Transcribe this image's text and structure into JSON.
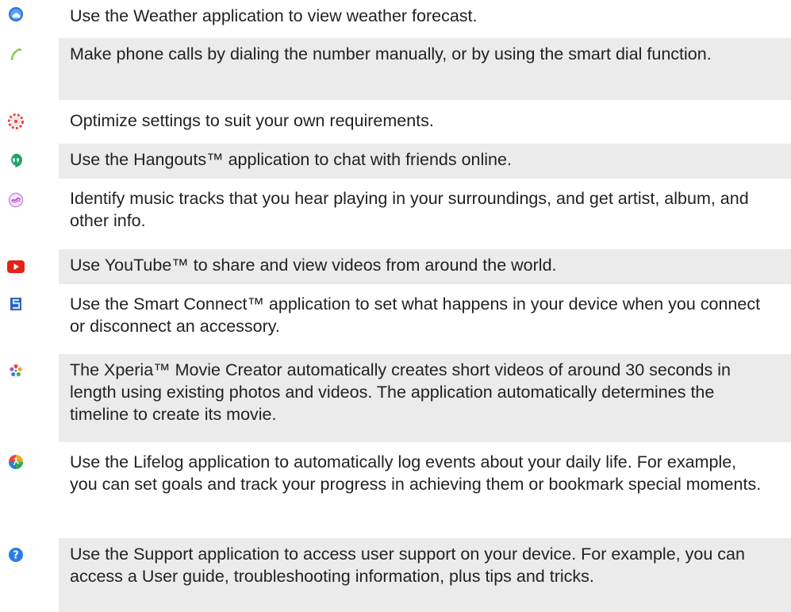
{
  "items": [
    {
      "icon": "weather-icon",
      "text": "Use the Weather application to view weather forecast."
    },
    {
      "icon": "phone-icon",
      "text": "Make phone calls by dialing the number manually, or by using the smart dial function."
    },
    {
      "icon": "settings-icon",
      "text": "Optimize settings to suit your own requirements."
    },
    {
      "icon": "hangouts-icon",
      "text": "Use the Hangouts™ application to chat with friends online."
    },
    {
      "icon": "trackid-icon",
      "text": "Identify music tracks that you hear playing in your surroundings, and get artist, album, and other info."
    },
    {
      "icon": "youtube-icon",
      "text": "Use YouTube™ to share and view videos from around the world."
    },
    {
      "icon": "smart-connect-icon",
      "text": "Use the Smart Connect™ application to set what happens in your device when you connect or disconnect an accessory."
    },
    {
      "icon": "movie-creator-icon",
      "text": "The Xperia™ Movie Creator automatically creates short videos of around 30 seconds in length using existing photos and videos. The application automatically determines the timeline to create its movie."
    },
    {
      "icon": "lifelog-icon",
      "text": "Use the Lifelog application to automatically log events about your daily life. For example, you can set goals and track your progress in achieving them or bookmark special moments."
    },
    {
      "icon": "support-icon",
      "text": "Use the Support application to access user support on your device. For example, you can access a User guide, troubleshooting information, plus tips and tricks."
    }
  ],
  "colors": {
    "row_shade": "#ebebeb",
    "text": "#222222",
    "youtube_red": "#e62117",
    "weather_blue": "#2a6fd6",
    "hangouts_green": "#1fa463",
    "support_blue": "#2b7de1"
  }
}
